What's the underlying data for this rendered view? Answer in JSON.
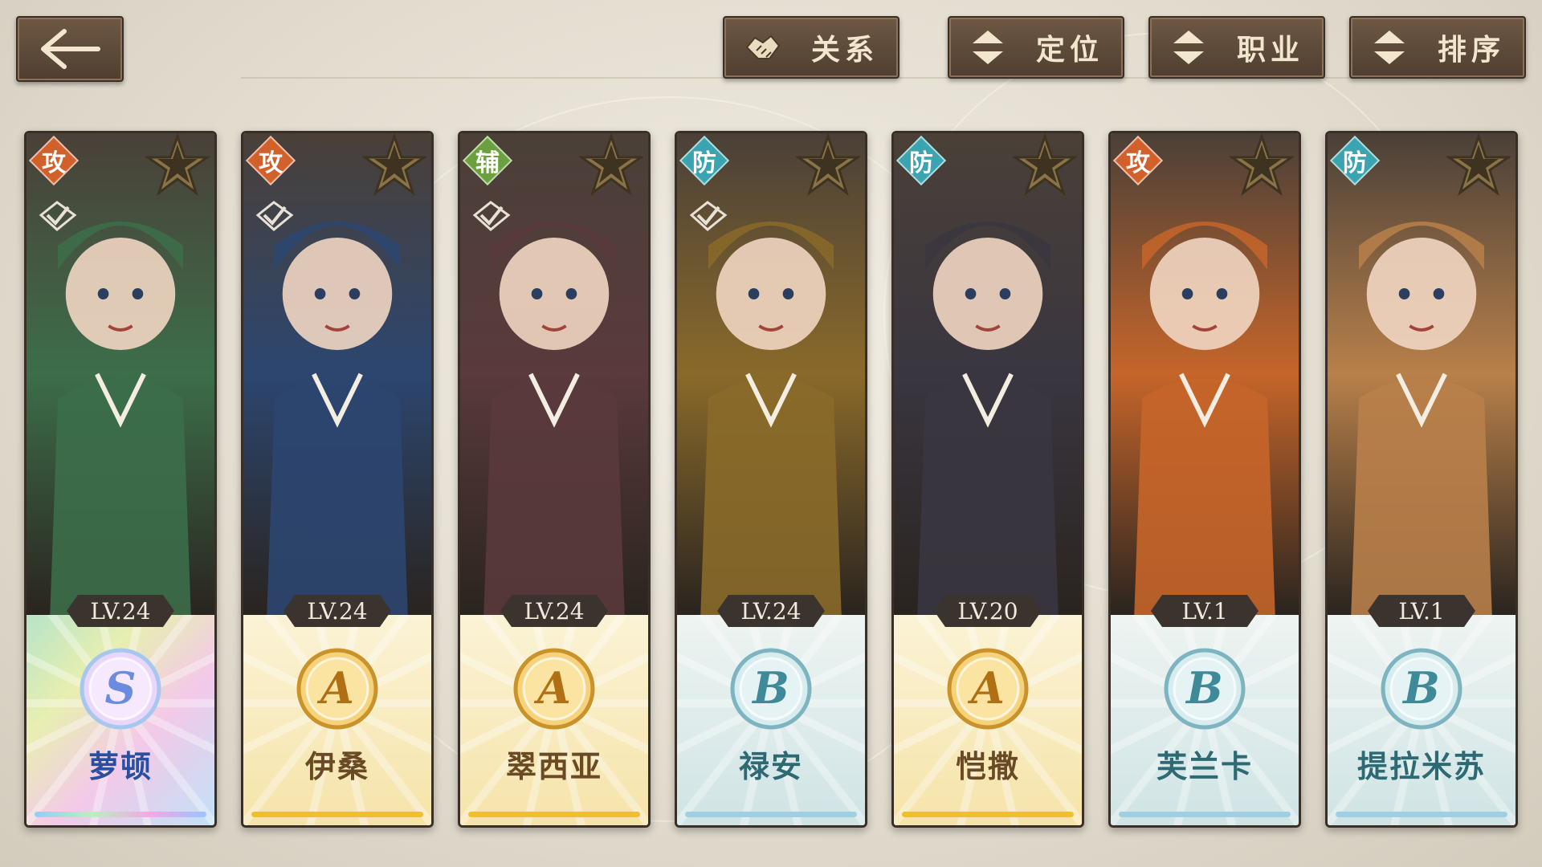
{
  "toolbar": {
    "relation_label": "关系",
    "position_label": "定位",
    "class_label": "职业",
    "sort_label": "排序"
  },
  "colors": {
    "attack_role": "#d2602b",
    "support_role": "#6aa03e",
    "defense_role": "#3aa5b0",
    "grade_S": "#c8b8f0",
    "grade_A": "#f0c02a",
    "grade_B": "#9fcfe0",
    "button_bg": "#5e4a3a"
  },
  "characters": [
    {
      "name": "萝顿",
      "level": "LV.24",
      "grade": "S",
      "role": "攻",
      "role_type": "atk",
      "selected": true,
      "theme": "#3c6e4a"
    },
    {
      "name": "伊桑",
      "level": "LV.24",
      "grade": "A",
      "role": "攻",
      "role_type": "atk",
      "selected": true,
      "theme": "#2c4670"
    },
    {
      "name": "翠西亚",
      "level": "LV.24",
      "grade": "A",
      "role": "辅",
      "role_type": "sup",
      "selected": true,
      "theme": "#5a3a3c"
    },
    {
      "name": "禄安",
      "level": "LV.24",
      "grade": "B",
      "role": "防",
      "role_type": "def",
      "selected": true,
      "theme": "#8a6a2a"
    },
    {
      "name": "恺撒",
      "level": "LV.20",
      "grade": "A",
      "role": "防",
      "role_type": "def",
      "selected": false,
      "theme": "#3a3640"
    },
    {
      "name": "芙兰卡",
      "level": "LV.1",
      "grade": "B",
      "role": "攻",
      "role_type": "atk",
      "selected": false,
      "theme": "#c5652a"
    },
    {
      "name": "提拉米苏",
      "level": "LV.1",
      "grade": "B",
      "role": "防",
      "role_type": "def",
      "selected": false,
      "theme": "#b8804a"
    }
  ]
}
